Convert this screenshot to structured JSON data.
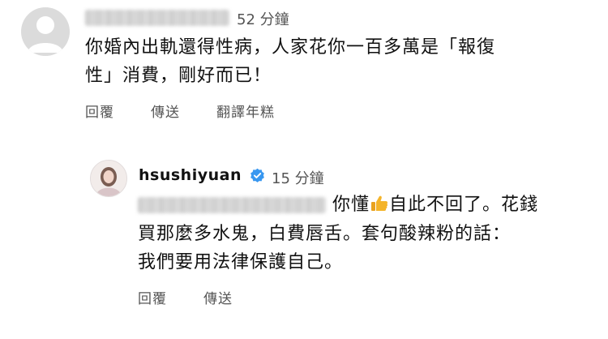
{
  "comment1": {
    "time": "52 分鐘",
    "line1": "你婚內出軌還得性病，人家花你一百多萬是「報復",
    "line2": "性」消費，剛好而已！",
    "actions": [
      "回覆",
      "傳送",
      "翻譯年糕"
    ]
  },
  "comment2": {
    "username": "hsushiyuan",
    "time": "15 分鐘",
    "line1_text1": "你懂",
    "line1_text2": "自此不回了。花錢",
    "line2": "買那麼多水鬼，白費唇舌。套句酸辣粉的話：",
    "line3": "我們要用法律保護自己。",
    "actions": [
      "回覆",
      "傳送"
    ]
  },
  "icons": {
    "default_avatar": "default-avatar-icon",
    "verified_badge": "verified-badge-icon",
    "thumbs_up": "thumbs-up-emoji"
  },
  "colors": {
    "verified": "#3897f0",
    "thumb": "#f4b42a"
  }
}
